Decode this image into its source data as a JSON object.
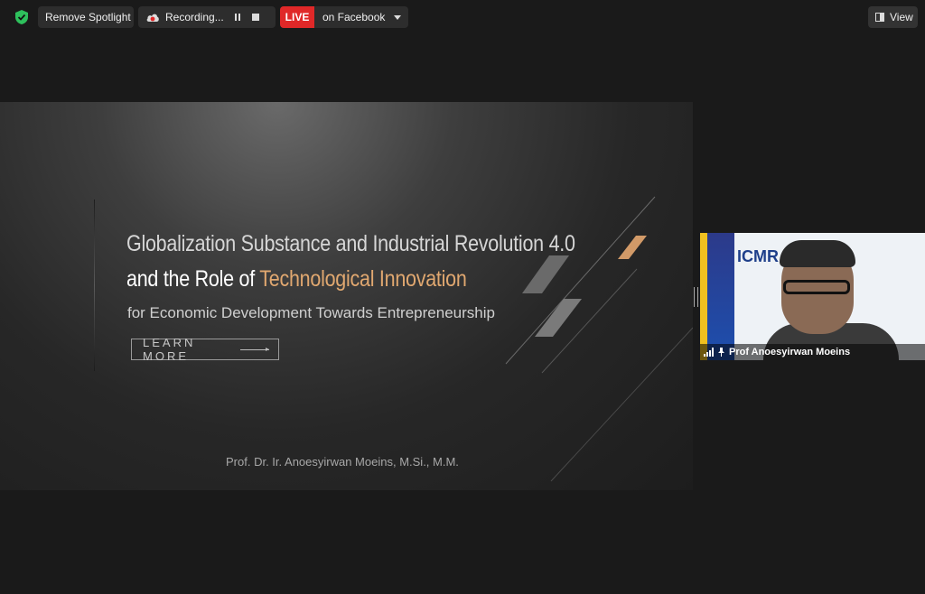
{
  "toolbar": {
    "spotlight_label": "Remove Spotlight",
    "recording_label": "Recording...",
    "live_badge": "LIVE",
    "live_target": "on Facebook",
    "view_label": "View"
  },
  "slide": {
    "title_line1": "Globalization Substance and Industrial Revolution 4.0",
    "title_line2_prefix": "and the Role of ",
    "title_line2_highlight": "Technological Innovation",
    "subtitle": "for Economic Development Towards Entrepreneurship",
    "button_label": "LEARN MORE",
    "author": "Prof. Dr. Ir. Anoesyirwan Moeins, M.Si., M.M.",
    "accent_color": "#e1a870"
  },
  "participant": {
    "name": "Prof Anoesyirwan Moeins",
    "background_title": "ICMR"
  },
  "colors": {
    "background": "#1a1a1a",
    "live_red": "#e02828",
    "shield_green": "#2ec05c"
  }
}
